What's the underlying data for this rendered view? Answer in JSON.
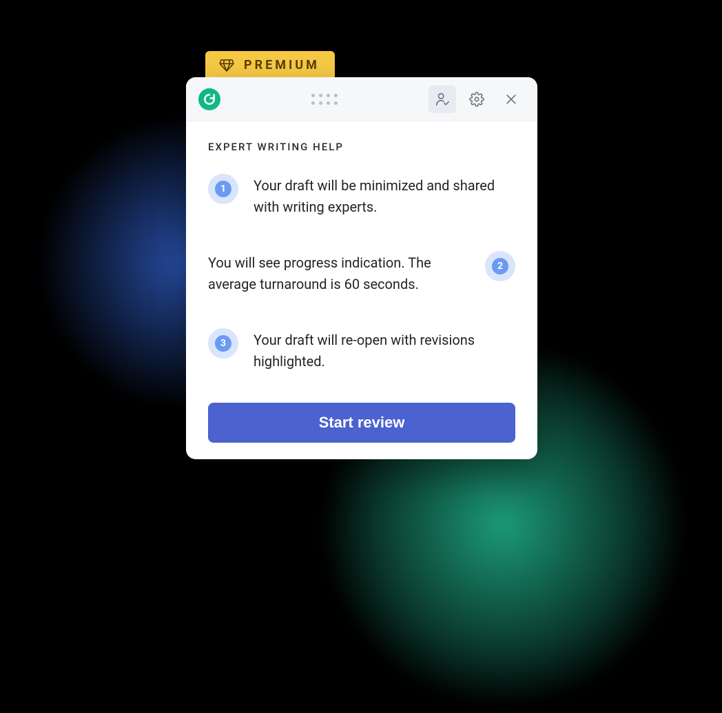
{
  "premium": {
    "label": "PREMIUM"
  },
  "header": {
    "icons": {
      "profile": "profile-check-icon",
      "settings": "gear-icon",
      "close": "close-icon"
    }
  },
  "section": {
    "title": "EXPERT WRITING HELP"
  },
  "steps": [
    {
      "num": "1",
      "text": "Your draft will be minimized and shared with writing experts."
    },
    {
      "num": "2",
      "text": "You will see progress indication. The average turnaround is 60 seconds."
    },
    {
      "num": "3",
      "text": "Your draft will re-open with revisions highlighted."
    }
  ],
  "cta": {
    "label": "Start review"
  },
  "colors": {
    "accent_green": "#11b786",
    "button": "#4b62cf",
    "premium_bg": "#f6c944",
    "badge_bg": "#d8e5fb",
    "badge_fg": "#6a9af2"
  }
}
